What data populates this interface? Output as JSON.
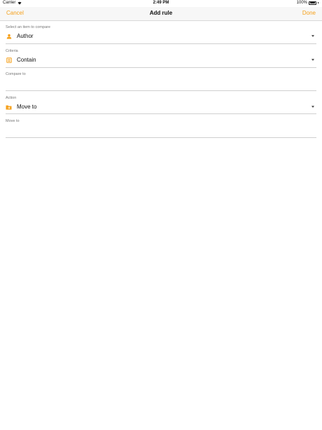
{
  "status_bar": {
    "carrier": "Carrier",
    "time": "2:49 PM",
    "battery": "100%"
  },
  "nav": {
    "cancel": "Cancel",
    "title": "Add rule",
    "done": "Done"
  },
  "accent_color": "#f6a01a",
  "fields": {
    "compare_item": {
      "label": "Select an item to compare",
      "value": "Author",
      "icon": "person-icon"
    },
    "criteria": {
      "label": "Criteria",
      "value": "Contain",
      "icon": "list-icon"
    },
    "compare_to": {
      "label": "Compare to",
      "value": ""
    },
    "action": {
      "label": "Action",
      "value": "Move to",
      "icon": "folder-icon"
    },
    "move_to": {
      "label": "Move to",
      "value": ""
    }
  }
}
